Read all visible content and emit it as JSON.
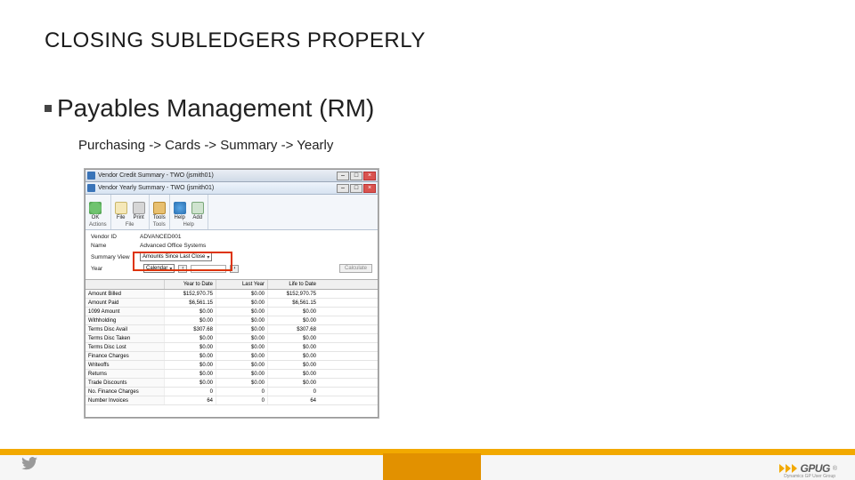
{
  "title": "CLOSING SUBLEDGERS PROPERLY",
  "section": "Payables Management (RM)",
  "breadcrumb": "Purchasing -> Cards -> Summary -> Yearly",
  "app": {
    "titlebar_back": "Vendor Credit Summary - TWO (jsmith01)",
    "titlebar_front": "Vendor Yearly Summary - TWO (jsmith01)",
    "toolbar": {
      "ok": "OK",
      "file": "File",
      "print": "Print",
      "tools": "Tools",
      "help": "Help",
      "add": "Add",
      "cap_actions": "Actions",
      "cap_file": "File",
      "cap_tools": "Tools",
      "cap_help": "Help"
    },
    "form": {
      "vendor_id_label": "Vendor ID",
      "vendor_id": "ADVANCED001",
      "name_label": "Name",
      "name": "Advanced Office Systems",
      "summary_view_label": "Summary View",
      "summary_view": "Amounts Since Last Close",
      "year_label": "Year",
      "calendar": "Calendar",
      "calculate": "Calculate"
    },
    "grid": {
      "headers": [
        "",
        "Year to Date",
        "Last Year",
        "Life to Date"
      ],
      "rows": [
        {
          "label": "Amount Billed",
          "ytd": "$152,970.75",
          "ly": "$0.00",
          "ltd": "$152,970.75"
        },
        {
          "label": "Amount Paid",
          "ytd": "$6,561.15",
          "ly": "$0.00",
          "ltd": "$6,561.15"
        },
        {
          "label": "1099 Amount",
          "ytd": "$0.00",
          "ly": "$0.00",
          "ltd": "$0.00"
        },
        {
          "label": "Withholding",
          "ytd": "$0.00",
          "ly": "$0.00",
          "ltd": "$0.00"
        },
        {
          "label": "Terms Disc Avail",
          "ytd": "$307.68",
          "ly": "$0.00",
          "ltd": "$307.68"
        },
        {
          "label": "Terms Disc Taken",
          "ytd": "$0.00",
          "ly": "$0.00",
          "ltd": "$0.00"
        },
        {
          "label": "Terms Disc Lost",
          "ytd": "$0.00",
          "ly": "$0.00",
          "ltd": "$0.00"
        },
        {
          "label": "Finance Charges",
          "ytd": "$0.00",
          "ly": "$0.00",
          "ltd": "$0.00"
        },
        {
          "label": "Writeoffs",
          "ytd": "$0.00",
          "ly": "$0.00",
          "ltd": "$0.00"
        },
        {
          "label": "Returns",
          "ytd": "$0.00",
          "ly": "$0.00",
          "ltd": "$0.00"
        },
        {
          "label": "Trade Discounts",
          "ytd": "$0.00",
          "ly": "$0.00",
          "ltd": "$0.00"
        },
        {
          "label": "No. Finance Charges",
          "ytd": "0",
          "ly": "0",
          "ltd": "0"
        },
        {
          "label": "Number Invoices",
          "ytd": "64",
          "ly": "0",
          "ltd": "64"
        }
      ]
    }
  },
  "footer": {
    "logo_text": "GPUG",
    "logo_sub": "Dynamics GP User Group",
    "reg": "®"
  }
}
